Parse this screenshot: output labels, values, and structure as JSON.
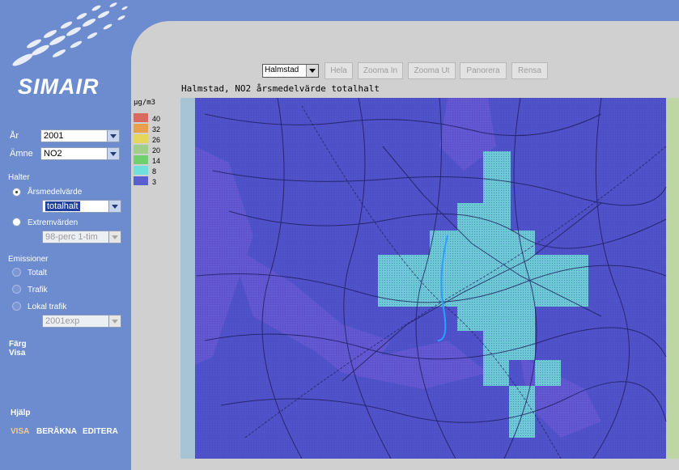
{
  "app": {
    "name": "SIMAIR"
  },
  "sidebar": {
    "year": {
      "label": "År",
      "value": "2001"
    },
    "substance": {
      "label": "Ämne",
      "value": "NO2"
    },
    "levels": {
      "heading": "Halter",
      "annual": {
        "label": "Årsmedelvärde",
        "selected": true,
        "dropdown": "totalhalt"
      },
      "extreme": {
        "label": "Extremvärden",
        "selected": false,
        "dropdown": "98-perc 1-tim"
      }
    },
    "emissions": {
      "heading": "Emissioner",
      "total": {
        "label": "Totalt"
      },
      "traffic": {
        "label": "Trafik"
      },
      "local": {
        "label": "Lokal trafik",
        "dropdown": "2001exp"
      }
    },
    "colour": {
      "line1": "Färg",
      "line2": "Visa"
    },
    "help": "Hjälp",
    "footer_nav": {
      "show": "VISA",
      "calculate": "BERÄKNA",
      "edit": "EDITERA"
    }
  },
  "toolbar": {
    "city": "Halmstad",
    "buttons": {
      "whole": "Hela",
      "zoom_in": "Zooma In",
      "zoom_out": "Zooma Ut",
      "pan": "Panorera",
      "clear": "Rensa"
    }
  },
  "map": {
    "title": "Halmstad, NO2 årsmedelvärde totalhalt"
  },
  "legend": {
    "unit": "µg/m3",
    "items": [
      {
        "label": "40",
        "color": "#d96a5d"
      },
      {
        "label": "32",
        "color": "#e9a04b"
      },
      {
        "label": "26",
        "color": "#e6d65a"
      },
      {
        "label": "20",
        "color": "#9fd08a"
      },
      {
        "label": "14",
        "color": "#6fd06f"
      },
      {
        "label": "8",
        "color": "#6fe0dc"
      },
      {
        "label": "3",
        "color": "#5a5fd0"
      }
    ]
  },
  "colors": {
    "sidebar": "#6c8ccf",
    "background": "#d0d0d0",
    "highlight": "#f5c98f",
    "map_base": "#4f52c8"
  }
}
